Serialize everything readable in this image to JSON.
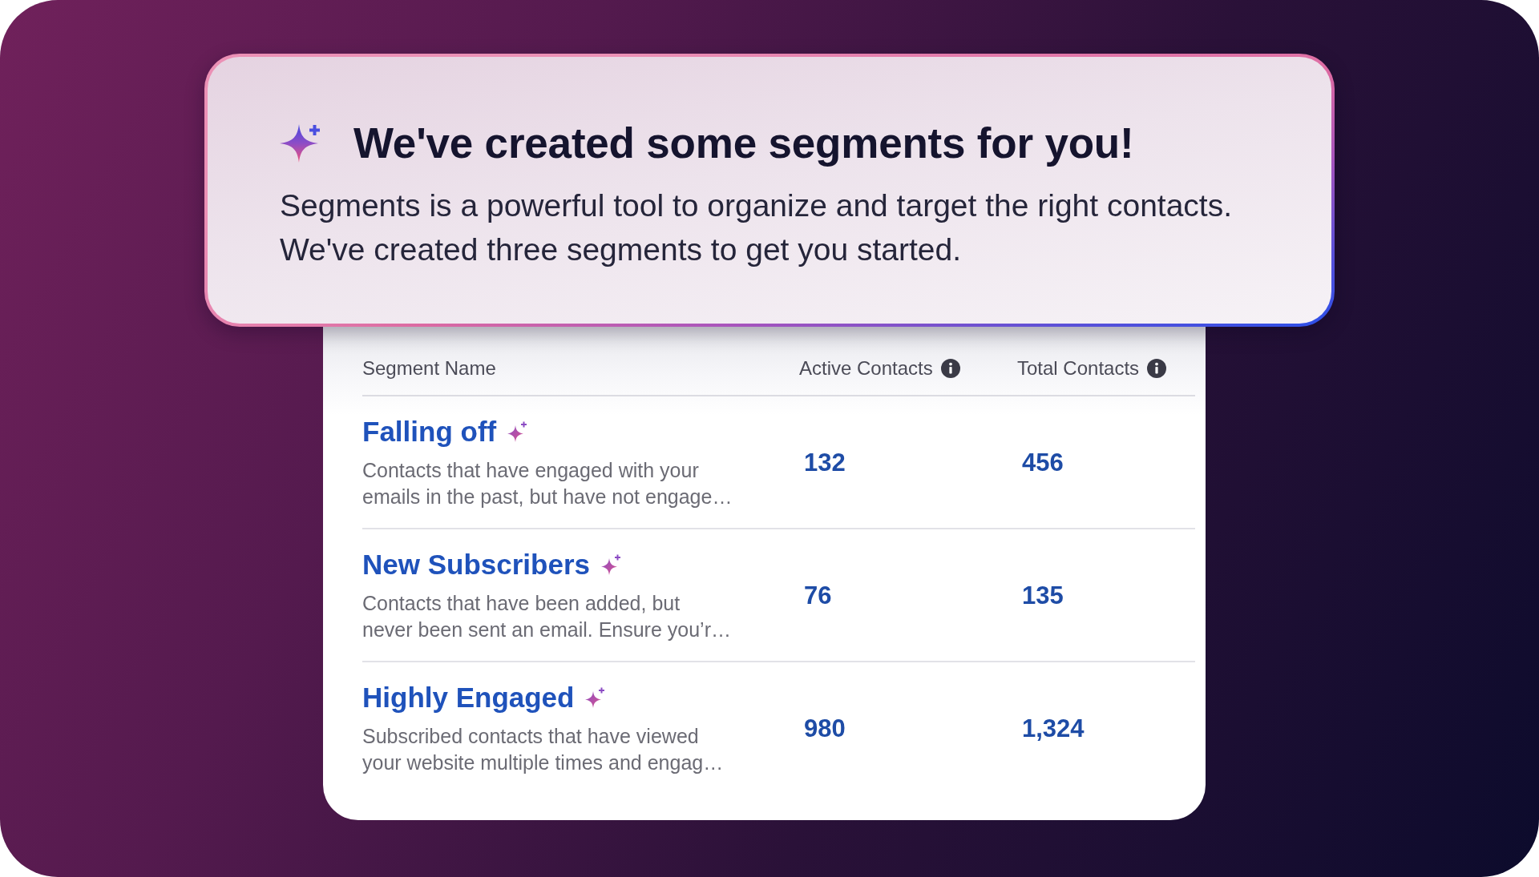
{
  "banner": {
    "title": "We've created some segments for you!",
    "description": "Segments is a powerful tool to organize and target the right contacts. We've created three segments to get you started."
  },
  "table": {
    "columns": [
      {
        "label": "Segment Name",
        "info": false
      },
      {
        "label": "Active Contacts",
        "info": true
      },
      {
        "label": "Total Contacts",
        "info": true
      }
    ],
    "rows": [
      {
        "name": "Falling off",
        "description": "Contacts that have engaged with your\nemails in the past, but have not engage…",
        "active_contacts": "132",
        "total_contacts": "456"
      },
      {
        "name": "New Subscribers",
        "description": "Contacts that have been added, but\nnever been sent an email. Ensure you’r…",
        "active_contacts": "76",
        "total_contacts": "135"
      },
      {
        "name": "Highly Engaged",
        "description": "Subscribed contacts that have viewed\nyour website multiple times and engag…",
        "active_contacts": "980",
        "total_contacts": "1,324"
      }
    ]
  }
}
